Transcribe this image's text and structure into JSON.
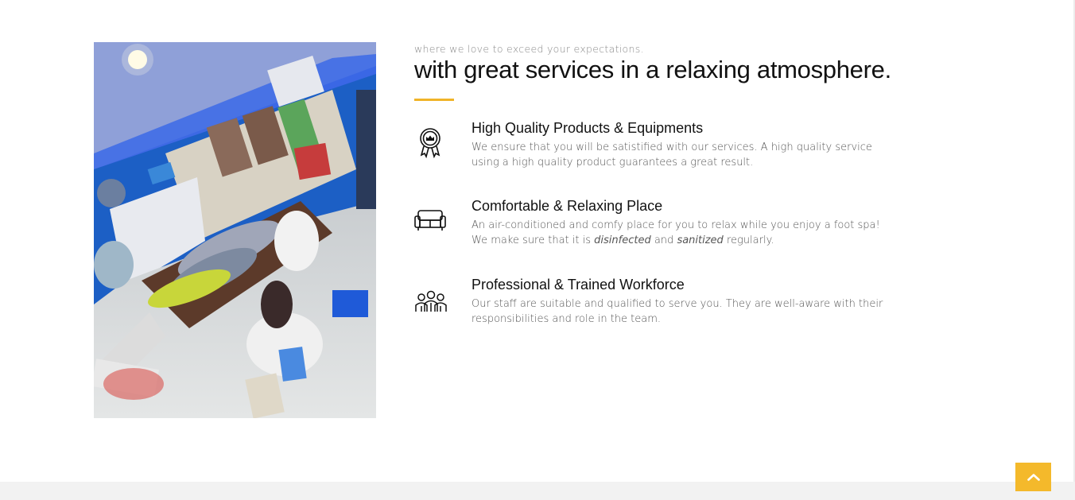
{
  "hero": {
    "tagline": "where we love to exceed your expectations.",
    "heading": "with great services in a relaxing atmosphere.",
    "accent_color": "#f0b428"
  },
  "features": [
    {
      "icon": "award-ribbon-icon",
      "title": "High Quality Products & Equipments",
      "description": "We ensure that you will be satistified with our services. A high quality service using a high quality product guarantees a great result."
    },
    {
      "icon": "sofa-icon",
      "title": "Comfortable & Relaxing Place",
      "description_before": "An air-conditioned and comfy place for you to relax while you enjoy a foot spa! We make sure that it is ",
      "description_em1": "disinfected",
      "description_mid": " and ",
      "description_em2": "sanitized",
      "description_after": " regularly."
    },
    {
      "icon": "team-icon",
      "title": "Professional & Trained Workforce",
      "description": "Our staff are suitable and qualified to serve you. They are well-aware with their responsibilities and role in the team."
    }
  ],
  "back_to_top": {
    "icon": "chevron-up-icon",
    "color": "#f4b92b"
  }
}
